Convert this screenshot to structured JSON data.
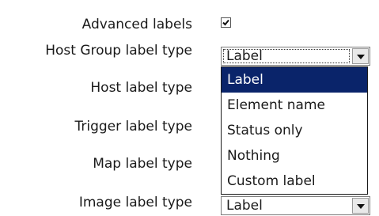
{
  "form": {
    "rows": [
      {
        "label": "Advanced labels"
      },
      {
        "label": "Host Group label type"
      },
      {
        "label": "Host label type"
      },
      {
        "label": "Trigger label type"
      },
      {
        "label": "Map label type"
      },
      {
        "label": "Image label type"
      }
    ],
    "advanced_labels_checked": true,
    "host_group_select": {
      "value": "Label"
    },
    "image_select": {
      "value": "Label"
    }
  },
  "dropdown": {
    "options": [
      {
        "label": "Label",
        "selected": true
      },
      {
        "label": "Element name",
        "selected": false
      },
      {
        "label": "Status only",
        "selected": false
      },
      {
        "label": "Nothing",
        "selected": false
      },
      {
        "label": "Custom label",
        "selected": false
      }
    ]
  },
  "colors": {
    "selected_option_bg": "#0a246a",
    "selected_option_text": "#ffffff"
  }
}
